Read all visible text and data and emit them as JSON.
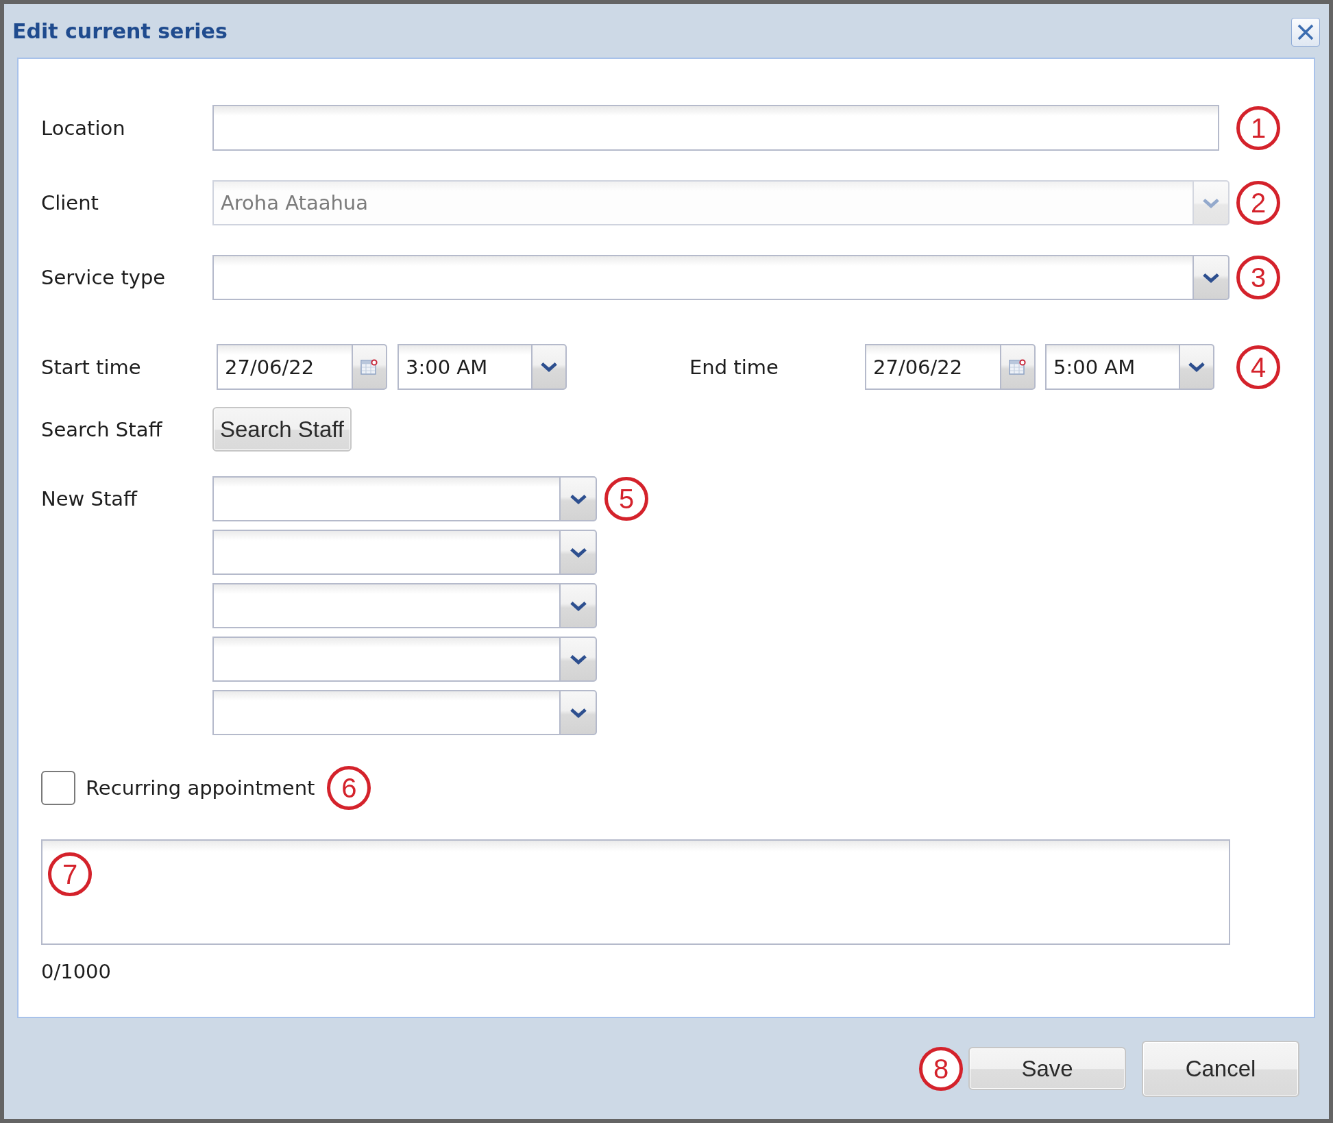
{
  "title": "Edit current series",
  "location": {
    "label": "Location",
    "callout": "1"
  },
  "client": {
    "label": "Client",
    "value": "Aroha Ataahua",
    "disabled": true,
    "callout": "2"
  },
  "service_type": {
    "label": "Service type",
    "disabled": false,
    "callout": "3"
  },
  "start_time": {
    "label": "Start time",
    "date": "27/06/22",
    "time": "3:00 AM"
  },
  "end_time": {
    "label": "End time",
    "date": "27/06/22",
    "time": "5:00 AM",
    "callout": "4"
  },
  "search_staff": {
    "label": "Search Staff",
    "button": "Search Staff"
  },
  "new_staff": {
    "label": "New Staff",
    "callout": "5",
    "dropdowns": [
      {
        "disabled": false
      },
      {
        "disabled": false
      },
      {
        "disabled": false
      },
      {
        "disabled": false
      },
      {
        "disabled": false
      }
    ]
  },
  "recurring": {
    "label": "Recurring appointment",
    "checked": false,
    "callout": "6"
  },
  "notes": {
    "callout": "7",
    "counter": "0/1000"
  },
  "buttons": [
    {
      "label": "Save",
      "callout": "8"
    },
    {
      "label": "Cancel"
    }
  ]
}
